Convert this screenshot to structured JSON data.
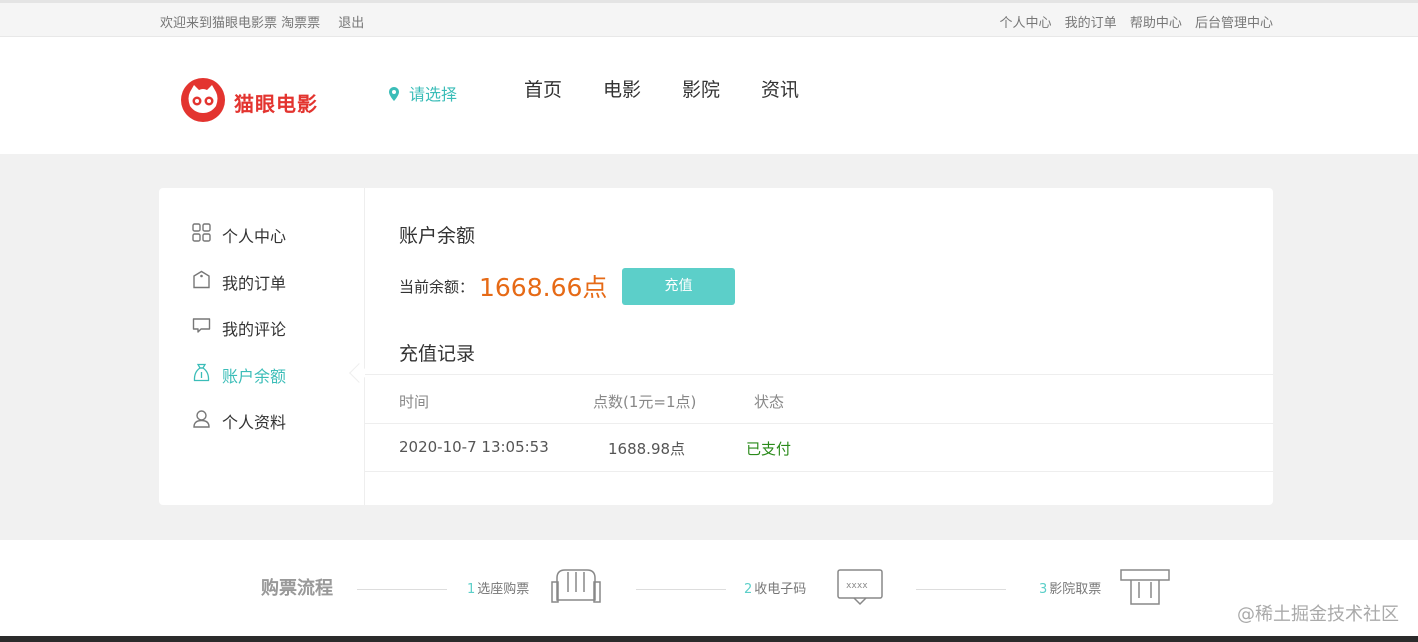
{
  "topbar": {
    "welcome": "欢迎来到猫眼电影票 淘票票",
    "logout": "退出",
    "links": [
      "个人中心",
      "我的订单",
      "帮助中心",
      "后台管理中心"
    ]
  },
  "header": {
    "logo_text": "猫眼电影",
    "city": "请选择",
    "nav": [
      "首页",
      "电影",
      "影院",
      "资讯"
    ]
  },
  "sidebar": {
    "items": [
      {
        "label": "个人中心",
        "icon": "grid-icon"
      },
      {
        "label": "我的订单",
        "icon": "order-tag-icon"
      },
      {
        "label": "我的评论",
        "icon": "comment-icon"
      },
      {
        "label": "账户余额",
        "icon": "wallet-icon",
        "active": true
      },
      {
        "label": "个人资料",
        "icon": "user-icon"
      }
    ]
  },
  "account": {
    "title": "账户余额",
    "balance_label": "当前余额：",
    "balance_value": "1668.66点",
    "recharge_button": "充值"
  },
  "records": {
    "title": "充值记录",
    "headers": [
      "时间",
      "点数(1元=1点)",
      "状态"
    ],
    "rows": [
      {
        "time": "2020-10-7 13:05:53",
        "points": "1688.98点",
        "status": "已支付"
      }
    ]
  },
  "process": {
    "title": "购票流程",
    "steps": [
      {
        "num": "1",
        "label": "选座购票"
      },
      {
        "num": "2",
        "label": "收电子码"
      },
      {
        "num": "3",
        "label": "影院取票"
      }
    ]
  },
  "watermark": "@稀土掘金技术社区",
  "colors": {
    "accent": "#3bbdb8",
    "button": "#5ccfc9",
    "brand": "#e3342f",
    "balance": "#e66a16",
    "paid": "#2a8a1a"
  }
}
